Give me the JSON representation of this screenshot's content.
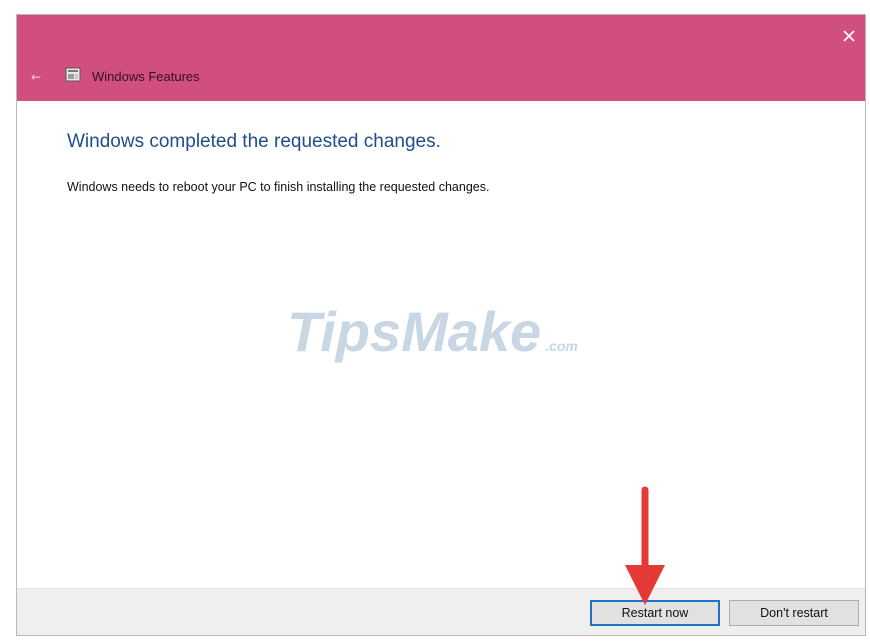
{
  "window": {
    "title": "Windows Features",
    "titlebar_color": "#d14e80",
    "title_icon": "windows-features-icon",
    "back_icon": "back-arrow-icon",
    "close_icon": "close-icon"
  },
  "content": {
    "heading": "Windows completed the requested changes.",
    "message": "Windows needs to reboot your PC to finish installing the requested changes."
  },
  "watermark": {
    "brand": "TipsMake",
    "suffix": ".com"
  },
  "buttons": {
    "restart_now": "Restart now",
    "dont_restart": "Don't restart"
  },
  "annotation": {
    "arrow_color": "#e53935",
    "points_to": "restart_now"
  }
}
